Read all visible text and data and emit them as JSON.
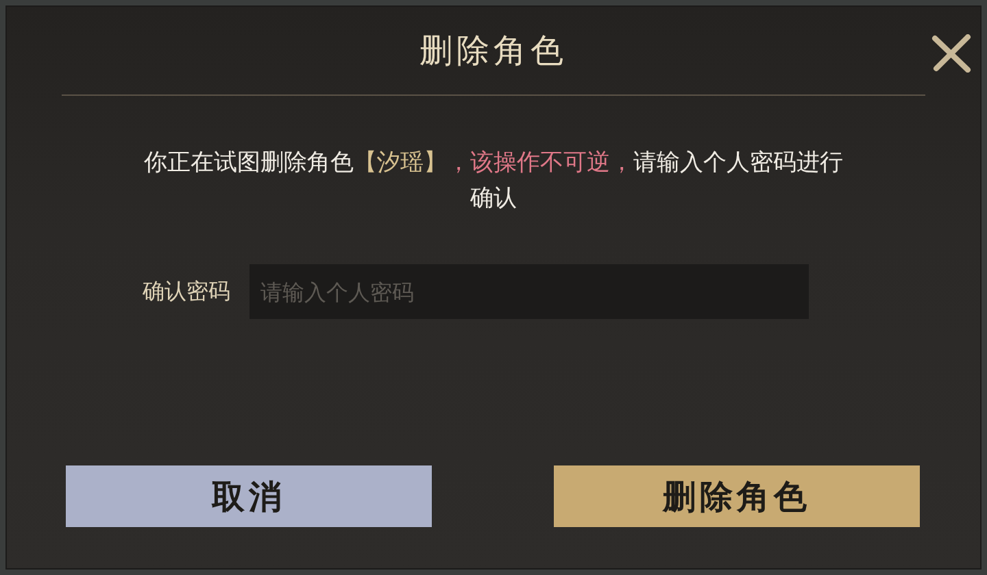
{
  "dialog": {
    "title": "删除角色",
    "message": [
      {
        "text": "你正在试图删除角色",
        "kind": "normal"
      },
      {
        "text": "【汐瑶】",
        "kind": "name"
      },
      {
        "text": "，该操作不可逆，",
        "kind": "warning"
      },
      {
        "text": "请输入个人密码进行确认",
        "kind": "normal"
      }
    ],
    "field": {
      "label": "确认密码",
      "placeholder": "请输入个人密码"
    },
    "buttons": [
      {
        "label": "取消",
        "kind": "cancel"
      },
      {
        "label": "删除角色",
        "kind": "confirm"
      }
    ]
  }
}
